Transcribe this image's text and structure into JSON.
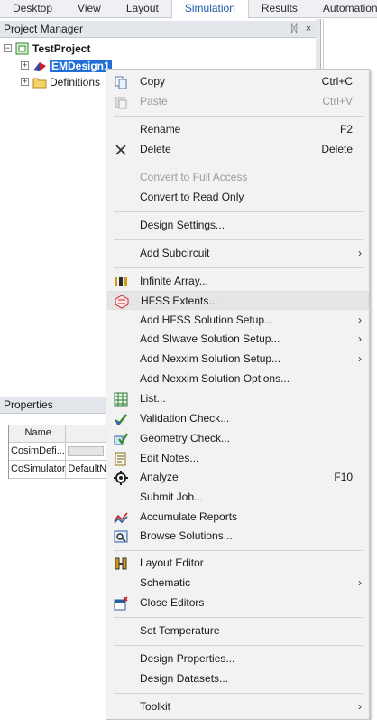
{
  "tabs": [
    "Desktop",
    "View",
    "Layout",
    "Simulation",
    "Results",
    "Automation"
  ],
  "active_tab": "Simulation",
  "project_manager": {
    "title": "Project Manager",
    "pin_glyph": "ᛞ",
    "close_glyph": "×",
    "tree": {
      "project": "TestProject",
      "design": "EMDesign1",
      "definitions": "Definitions"
    }
  },
  "properties": {
    "title": "Properties",
    "columns": [
      "Name",
      ""
    ],
    "rows": [
      {
        "name": "CosimDefi...",
        "value": ""
      },
      {
        "name": "CoSimulator",
        "value": "DefaultN"
      }
    ]
  },
  "context_menu": {
    "items": {
      "copy": {
        "label": "Copy",
        "shortcut": "Ctrl+C"
      },
      "paste": {
        "label": "Paste",
        "shortcut": "Ctrl+V"
      },
      "rename": {
        "label": "Rename",
        "shortcut": "F2"
      },
      "delete": {
        "label": "Delete",
        "shortcut": "Delete"
      },
      "convert_full": {
        "label": "Convert to Full Access"
      },
      "convert_read": {
        "label": "Convert to Read Only"
      },
      "design_settings": {
        "label": "Design Settings..."
      },
      "add_subcircuit": {
        "label": "Add Subcircuit"
      },
      "infinite_array": {
        "label": "Infinite Array..."
      },
      "hfss_extents": {
        "label": "HFSS Extents..."
      },
      "add_hfss": {
        "label": "Add HFSS Solution Setup..."
      },
      "add_siwave": {
        "label": "Add SIwave Solution Setup..."
      },
      "add_nexxim": {
        "label": "Add Nexxim Solution Setup..."
      },
      "add_nexxim_opt": {
        "label": "Add Nexxim Solution Options..."
      },
      "list": {
        "label": "List..."
      },
      "validation": {
        "label": "Validation Check..."
      },
      "geometry": {
        "label": "Geometry Check..."
      },
      "edit_notes": {
        "label": "Edit Notes..."
      },
      "analyze": {
        "label": "Analyze",
        "shortcut": "F10"
      },
      "submit_job": {
        "label": "Submit Job..."
      },
      "accumulate": {
        "label": "Accumulate Reports"
      },
      "browse": {
        "label": "Browse Solutions..."
      },
      "layout_editor": {
        "label": "Layout Editor"
      },
      "schematic": {
        "label": "Schematic"
      },
      "close_editors": {
        "label": "Close Editors"
      },
      "set_temperature": {
        "label": "Set Temperature"
      },
      "design_properties": {
        "label": "Design Properties..."
      },
      "design_datasets": {
        "label": "Design Datasets..."
      },
      "toolkit": {
        "label": "Toolkit"
      }
    },
    "submenu_arrow": "›"
  },
  "colors": {
    "accent": "#1f6fd6",
    "menu_bg": "#f2f2f2",
    "disabled_text": "#9a9a9a"
  }
}
